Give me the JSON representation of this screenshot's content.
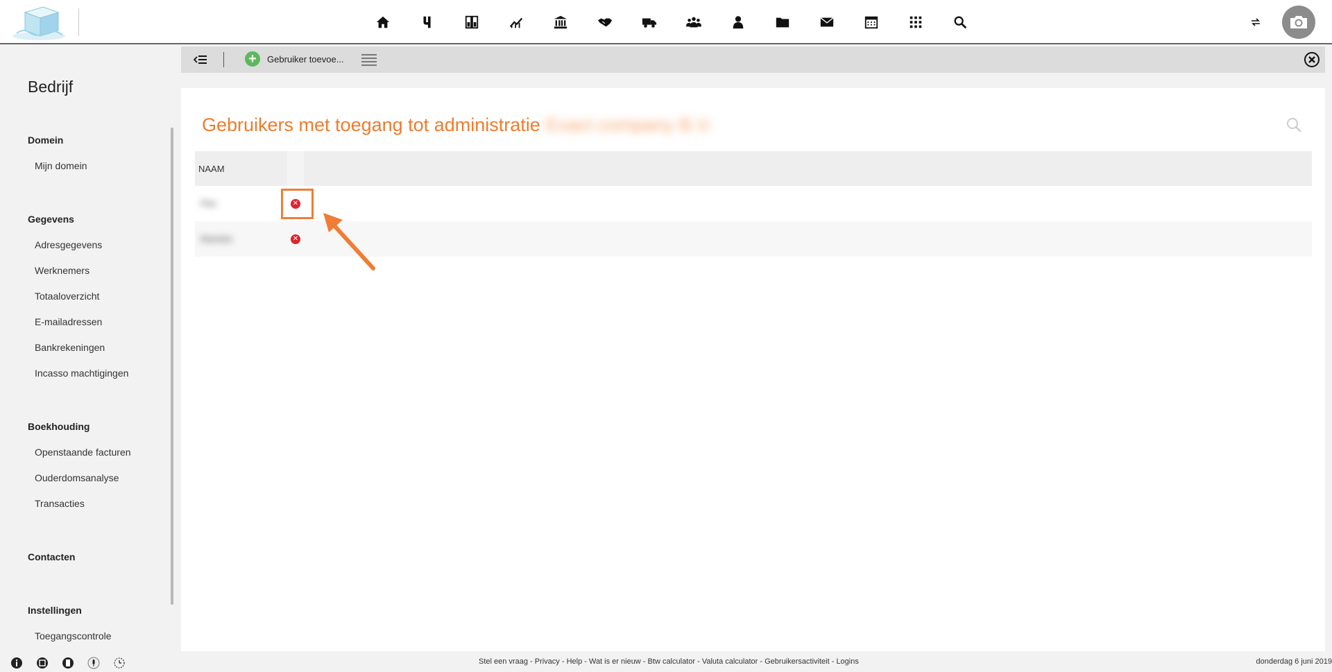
{
  "topbar": {
    "nav_icons": [
      "home-icon",
      "yuki-icon",
      "dashboard-icon",
      "reports-icon",
      "bank-icon",
      "handshake-icon",
      "delivery-truck-icon",
      "team-icon",
      "person-icon",
      "folder-icon",
      "mail-icon",
      "calendar-icon",
      "apps-grid-icon",
      "search-icon"
    ]
  },
  "sidebar": {
    "title": "Bedrijf",
    "sections": [
      {
        "heading": "Domein",
        "items": [
          "Mijn domein"
        ]
      },
      {
        "heading": "Gegevens",
        "items": [
          "Adresgegevens",
          "Werknemers",
          "Totaaloverzicht",
          "E-mailadressen",
          "Bankrekeningen",
          "Incasso machtigingen"
        ]
      },
      {
        "heading": "Boekhouding",
        "items": [
          "Openstaande facturen",
          "Ouderdomsanalyse",
          "Transacties"
        ]
      },
      {
        "heading": "Contacten",
        "items": []
      },
      {
        "heading": "Instellingen",
        "items": [
          "Toegangscontrole"
        ]
      }
    ]
  },
  "toolbar": {
    "add_user_label": "Gebruiker toevoe..."
  },
  "panel": {
    "title": "Gebruikers met toegang tot administratie",
    "title_blurred": "Exact company B.V.",
    "table": {
      "headers": [
        "NAAM"
      ],
      "rows": [
        {
          "name": "Piet"
        },
        {
          "name": "Marieke"
        }
      ]
    }
  },
  "footer": {
    "links": [
      "Stel een vraag",
      "Privacy",
      "Help",
      "Wat is er nieuw",
      "Btw calculator",
      "Valuta calculator",
      "Gebruikersactiviteit",
      "Logins"
    ],
    "date": "donderdag 6 juni 2019"
  },
  "colors": {
    "accent": "#f07b2c",
    "delete": "#d9262e",
    "add": "#5cb85c"
  }
}
